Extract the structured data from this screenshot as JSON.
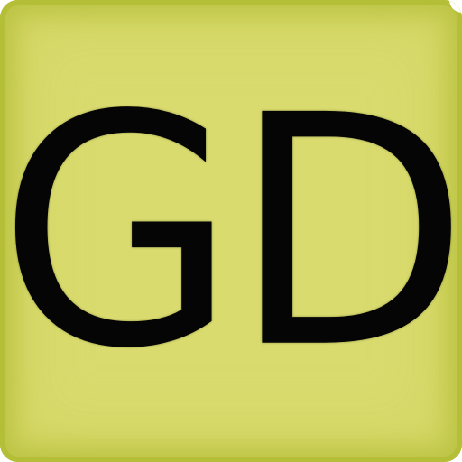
{
  "icon": {
    "text": "GD",
    "background_color": "#d9db6e",
    "border_color": "#b4be37",
    "text_color": "#050505"
  }
}
